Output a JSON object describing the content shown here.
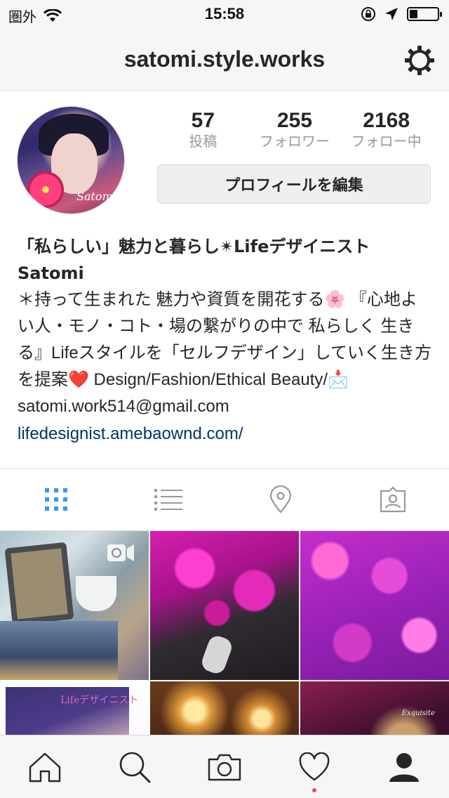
{
  "status_bar": {
    "carrier": "圏外",
    "time": "15:58",
    "battery_level": 0.3
  },
  "nav": {
    "title": "satomi.style.works",
    "settings_icon": "gear-icon"
  },
  "profile": {
    "avatar_signature": "Satomi",
    "stats": [
      {
        "value": "57",
        "label": "投稿"
      },
      {
        "value": "255",
        "label": "フォロワー"
      },
      {
        "value": "2168",
        "label": "フォロー中"
      }
    ],
    "edit_button_label": "プロフィールを編集",
    "bio_name_line1": "「私らしい」魅力と暮らし✴︎Lifeデザイニスト",
    "bio_name_line2": "Satomi",
    "bio_text": "＊持って生まれた 魅力や資質を開花する🌸 『心地よい人・モノ・コト・場の繋がりの中で 私らしく 生きる』Lifeスタイルを「セルフデザイン」していく生き方を提案❤️ Design/Fashion/Ethical Beauty/📩satomi.work514@gmail.com",
    "bio_link": "lifedesignist.amebaownd.com/"
  },
  "tabs": [
    {
      "icon": "grid-icon",
      "active": true
    },
    {
      "icon": "list-icon",
      "active": false
    },
    {
      "icon": "location-pin-icon",
      "active": false
    },
    {
      "icon": "tagged-photos-icon",
      "active": false
    }
  ],
  "grid": {
    "posts": [
      {
        "kind": "video",
        "overlay_icon": "video-camera-icon"
      },
      {
        "kind": "photo"
      },
      {
        "kind": "photo"
      },
      {
        "kind": "photo",
        "caption_text": "Lifeデザイニスト"
      },
      {
        "kind": "photo"
      },
      {
        "kind": "photo",
        "caption_text": "Exquisite"
      }
    ]
  },
  "bottom_bar": [
    {
      "icon": "home-icon"
    },
    {
      "icon": "search-icon"
    },
    {
      "icon": "camera-icon"
    },
    {
      "icon": "heart-icon",
      "notification_dot": true
    },
    {
      "icon": "profile-icon",
      "active": true
    }
  ],
  "colors": {
    "accent_blue": "#3897f0",
    "link": "#003569",
    "notification": "#ed4956"
  }
}
